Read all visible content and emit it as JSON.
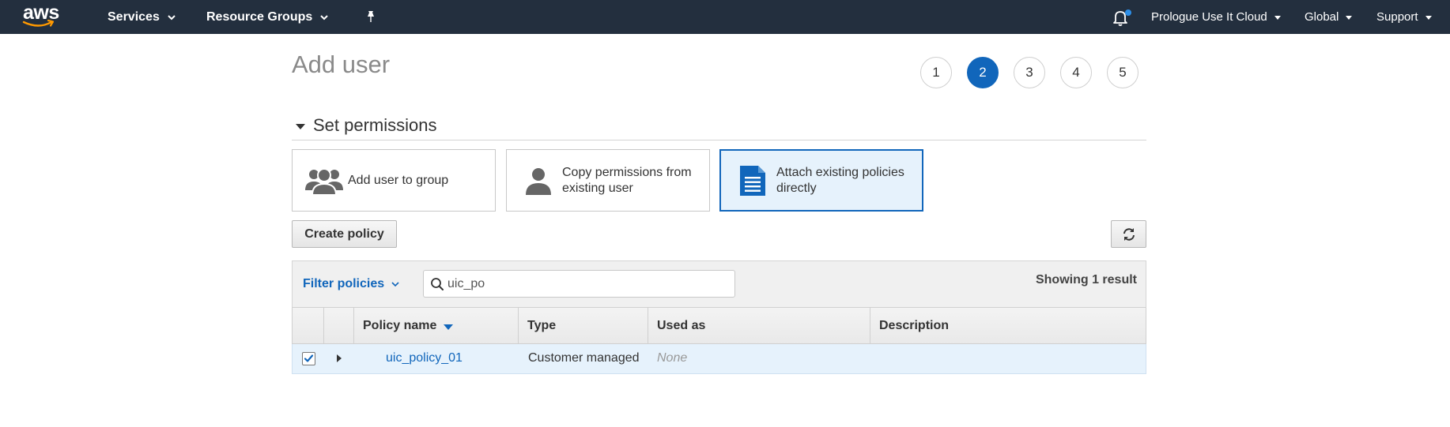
{
  "nav": {
    "logo_text": "aws",
    "services": "Services",
    "resource_groups": "Resource Groups",
    "pin_icon": "pin-icon",
    "notifications_icon": "bell-icon",
    "account": "Prologue Use It Cloud",
    "region": "Global",
    "support": "Support"
  },
  "page": {
    "title": "Add user",
    "steps": [
      "1",
      "2",
      "3",
      "4",
      "5"
    ],
    "active_step": "2"
  },
  "section": {
    "title": "Set permissions"
  },
  "options": [
    {
      "label": "Add user to group",
      "icon": "group-icon",
      "selected": false
    },
    {
      "label": "Copy permissions from existing user",
      "icon": "user-icon",
      "selected": false
    },
    {
      "label": "Attach existing policies directly",
      "icon": "document-icon",
      "selected": true
    }
  ],
  "toolbar": {
    "create_policy": "Create policy",
    "refresh_icon": "refresh-icon"
  },
  "filter": {
    "label": "Filter policies",
    "search_value": "uic_po",
    "showing": "Showing 1 result"
  },
  "table": {
    "columns": [
      "Policy name",
      "Type",
      "Used as",
      "Description"
    ],
    "rows": [
      {
        "checked": true,
        "policy_name": "uic_policy_01",
        "type": "Customer managed",
        "used_as": "None",
        "description": ""
      }
    ]
  },
  "colors": {
    "nav_bg": "#232f3e",
    "accent": "#1166bb",
    "selected_bg": "#e6f2fc"
  }
}
